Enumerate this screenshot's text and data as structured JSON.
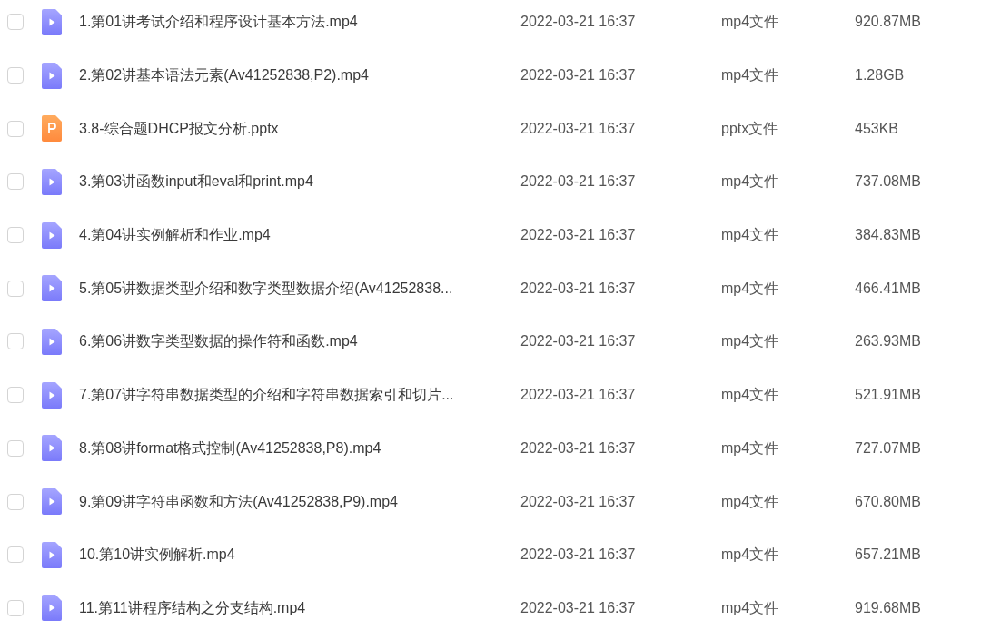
{
  "files": [
    {
      "name": "1.第01讲考试介绍和程序设计基本方法.mp4",
      "kind": "video",
      "checked": false,
      "date": "2022-03-21 16:37",
      "type": "mp4文件",
      "size": "920.87MB"
    },
    {
      "name": "2.第02讲基本语法元素(Av41252838,P2).mp4",
      "kind": "video",
      "checked": false,
      "date": "2022-03-21 16:37",
      "type": "mp4文件",
      "size": "1.28GB"
    },
    {
      "name": "3.8-综合题DHCP报文分析.pptx",
      "kind": "slides",
      "checked": false,
      "date": "2022-03-21 16:37",
      "type": "pptx文件",
      "size": "453KB"
    },
    {
      "name": "3.第03讲函数input和eval和print.mp4",
      "kind": "video",
      "checked": false,
      "date": "2022-03-21 16:37",
      "type": "mp4文件",
      "size": "737.08MB"
    },
    {
      "name": "4.第04讲实例解析和作业.mp4",
      "kind": "video",
      "checked": false,
      "date": "2022-03-21 16:37",
      "type": "mp4文件",
      "size": "384.83MB"
    },
    {
      "name": "5.第05讲数据类型介绍和数字类型数据介绍(Av41252838...",
      "kind": "video",
      "checked": false,
      "date": "2022-03-21 16:37",
      "type": "mp4文件",
      "size": "466.41MB"
    },
    {
      "name": "6.第06讲数字类型数据的操作符和函数.mp4",
      "kind": "video",
      "checked": false,
      "date": "2022-03-21 16:37",
      "type": "mp4文件",
      "size": "263.93MB"
    },
    {
      "name": "7.第07讲字符串数据类型的介绍和字符串数据索引和切片...",
      "kind": "video",
      "checked": false,
      "date": "2022-03-21 16:37",
      "type": "mp4文件",
      "size": "521.91MB"
    },
    {
      "name": "8.第08讲format格式控制(Av41252838,P8).mp4",
      "kind": "video",
      "checked": false,
      "date": "2022-03-21 16:37",
      "type": "mp4文件",
      "size": "727.07MB"
    },
    {
      "name": "9.第09讲字符串函数和方法(Av41252838,P9).mp4",
      "kind": "video",
      "checked": false,
      "date": "2022-03-21 16:37",
      "type": "mp4文件",
      "size": "670.80MB"
    },
    {
      "name": "10.第10讲实例解析.mp4",
      "kind": "video",
      "checked": false,
      "date": "2022-03-21 16:37",
      "type": "mp4文件",
      "size": "657.21MB"
    },
    {
      "name": "11.第11讲程序结构之分支结构.mp4",
      "kind": "video",
      "checked": false,
      "date": "2022-03-21 16:37",
      "type": "mp4文件",
      "size": "919.68MB"
    }
  ]
}
